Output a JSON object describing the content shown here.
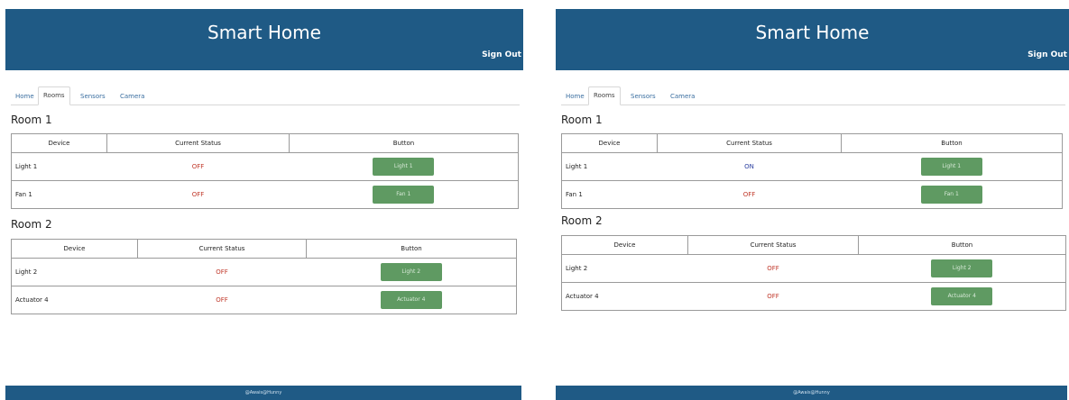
{
  "left": {
    "header": {
      "title": "Smart Home",
      "signout": "Sign Out"
    },
    "tabs": [
      "Home",
      "Rooms",
      "Sensors",
      "Camera"
    ],
    "rooms": [
      {
        "title": "Room 1",
        "columns": [
          "Device",
          "Current Status",
          "Button"
        ],
        "rows": [
          {
            "device": "Light 1",
            "status": "OFF",
            "button": "Light 1"
          },
          {
            "device": "Fan 1",
            "status": "OFF",
            "button": "Fan 1"
          }
        ]
      },
      {
        "title": "Room 2",
        "columns": [
          "Device",
          "Current Status",
          "Button"
        ],
        "rows": [
          {
            "device": "Light 2",
            "status": "OFF",
            "button": "Light 2"
          },
          {
            "device": "Actuator 4",
            "status": "OFF",
            "button": "Actuator 4"
          }
        ]
      }
    ],
    "footer": "@Awais@Hunny"
  },
  "right": {
    "header": {
      "title": "Smart Home",
      "signout": "Sign Out"
    },
    "tabs": [
      "Home",
      "Rooms",
      "Sensors",
      "Camera"
    ],
    "rooms": [
      {
        "title": "Room 1",
        "columns": [
          "Device",
          "Current Status",
          "Button"
        ],
        "rows": [
          {
            "device": "Light 1",
            "status": "ON",
            "button": "Light 1"
          },
          {
            "device": "Fan 1",
            "status": "OFF",
            "button": "Fan 1"
          }
        ]
      },
      {
        "title": "Room 2",
        "columns": [
          "Device",
          "Current Status",
          "Button"
        ],
        "rows": [
          {
            "device": "Light 2",
            "status": "OFF",
            "button": "Light 2"
          },
          {
            "device": "Actuator 4",
            "status": "OFF",
            "button": "Actuator 4"
          }
        ]
      }
    ],
    "footer": "@Awais@Hunny"
  },
  "colors": {
    "header": "#1f5a85",
    "button": "#5f9a62",
    "status_off": "#c0392b",
    "status_on": "#2b3fa0",
    "link": "#3a6ea0"
  }
}
